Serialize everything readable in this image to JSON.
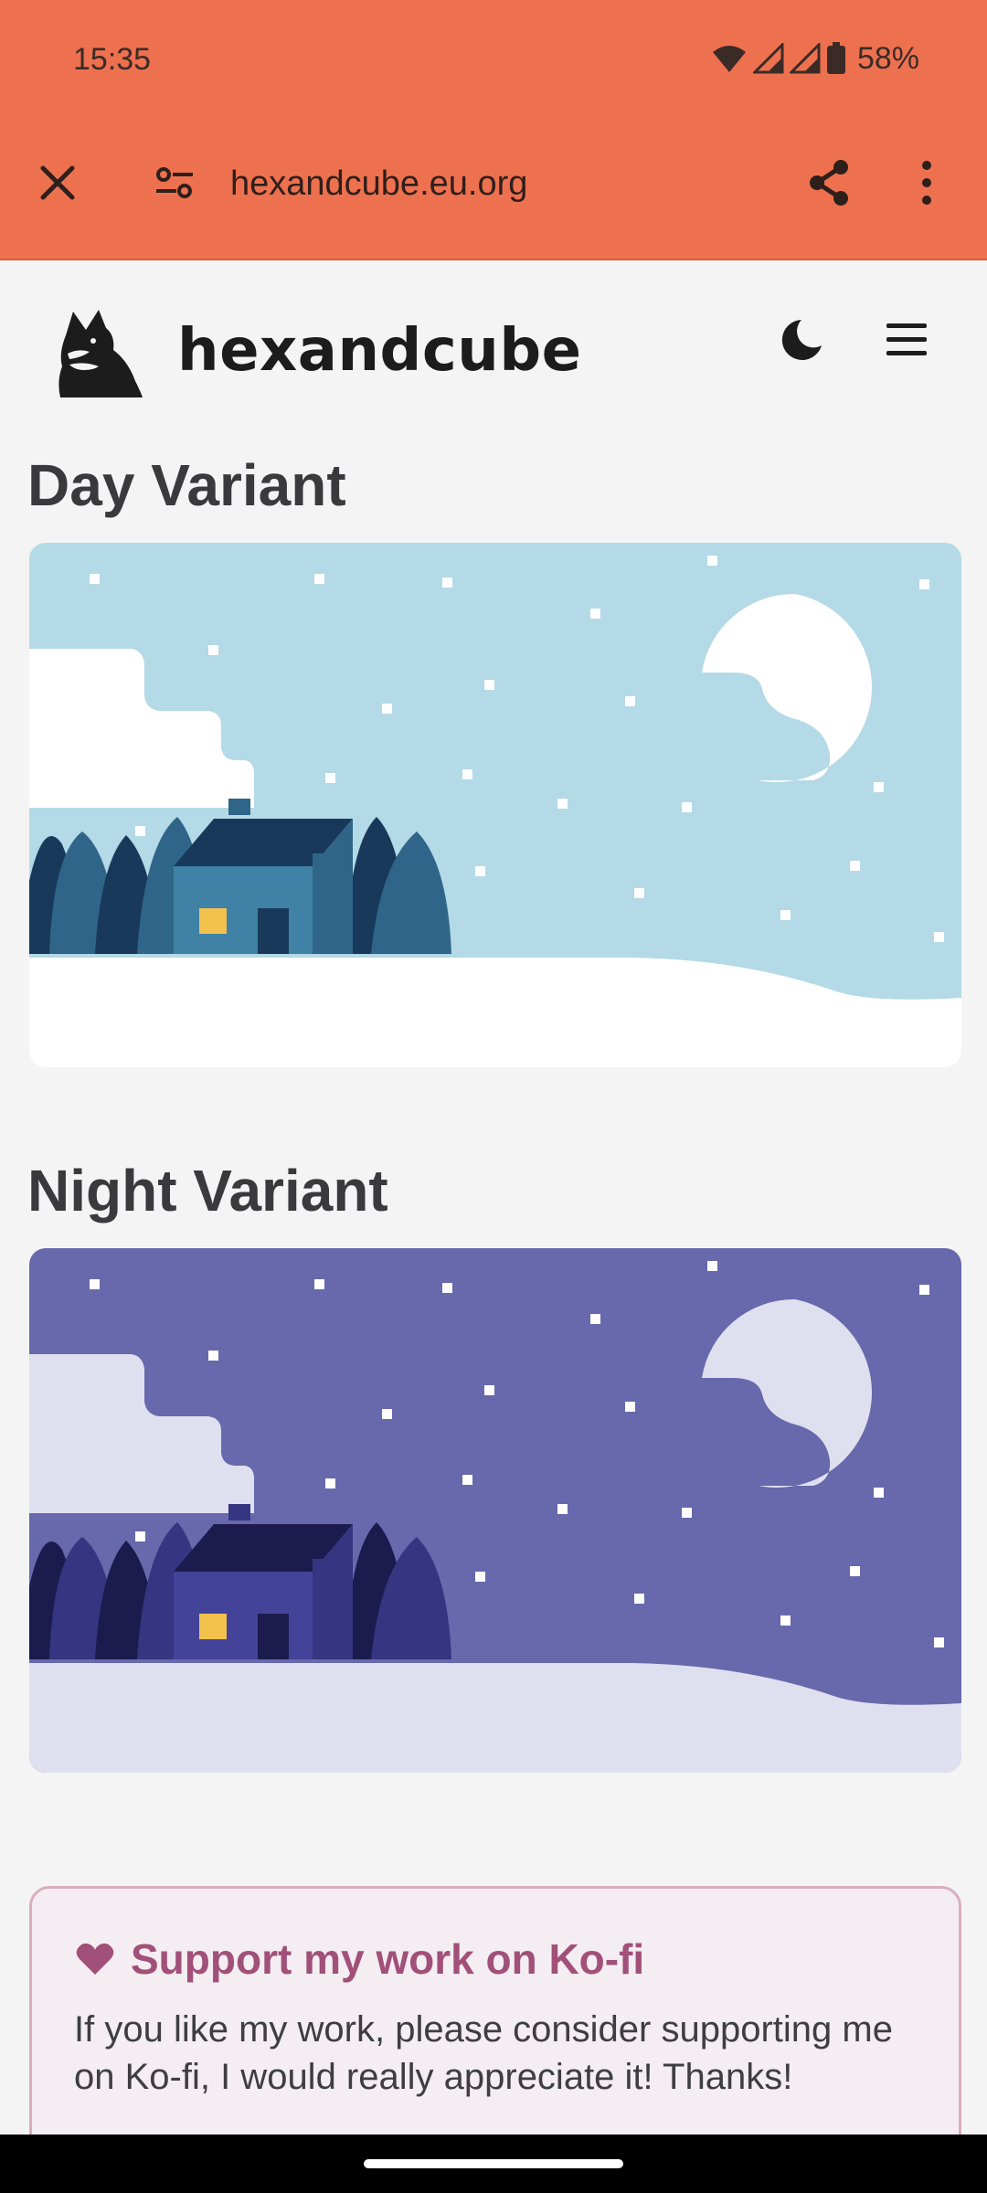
{
  "status": {
    "time": "15:35",
    "battery": "58%"
  },
  "browser": {
    "url": "hexandcube.eu.org"
  },
  "site": {
    "brand": "hexandcube"
  },
  "sections": [
    {
      "title": "Day Variant"
    },
    {
      "title": "Night Variant"
    }
  ],
  "kofi": {
    "title": "Support my work on Ko-fi",
    "body": "If you like my work, please consider supporting me on Ko-fi, I would really appreciate it! Thanks!"
  },
  "colors": {
    "accent_bar": "#ee714f",
    "day_sky": "#b4d9e7",
    "night_sky": "#6868ac",
    "kofi_accent": "#a15079"
  },
  "icons": [
    "close-icon",
    "site-settings-icon",
    "share-icon",
    "more-vert-icon",
    "fox-logo-icon",
    "moon-icon",
    "hamburger-menu-icon",
    "heart-icon",
    "wifi-icon",
    "signal-icon",
    "battery-icon"
  ]
}
